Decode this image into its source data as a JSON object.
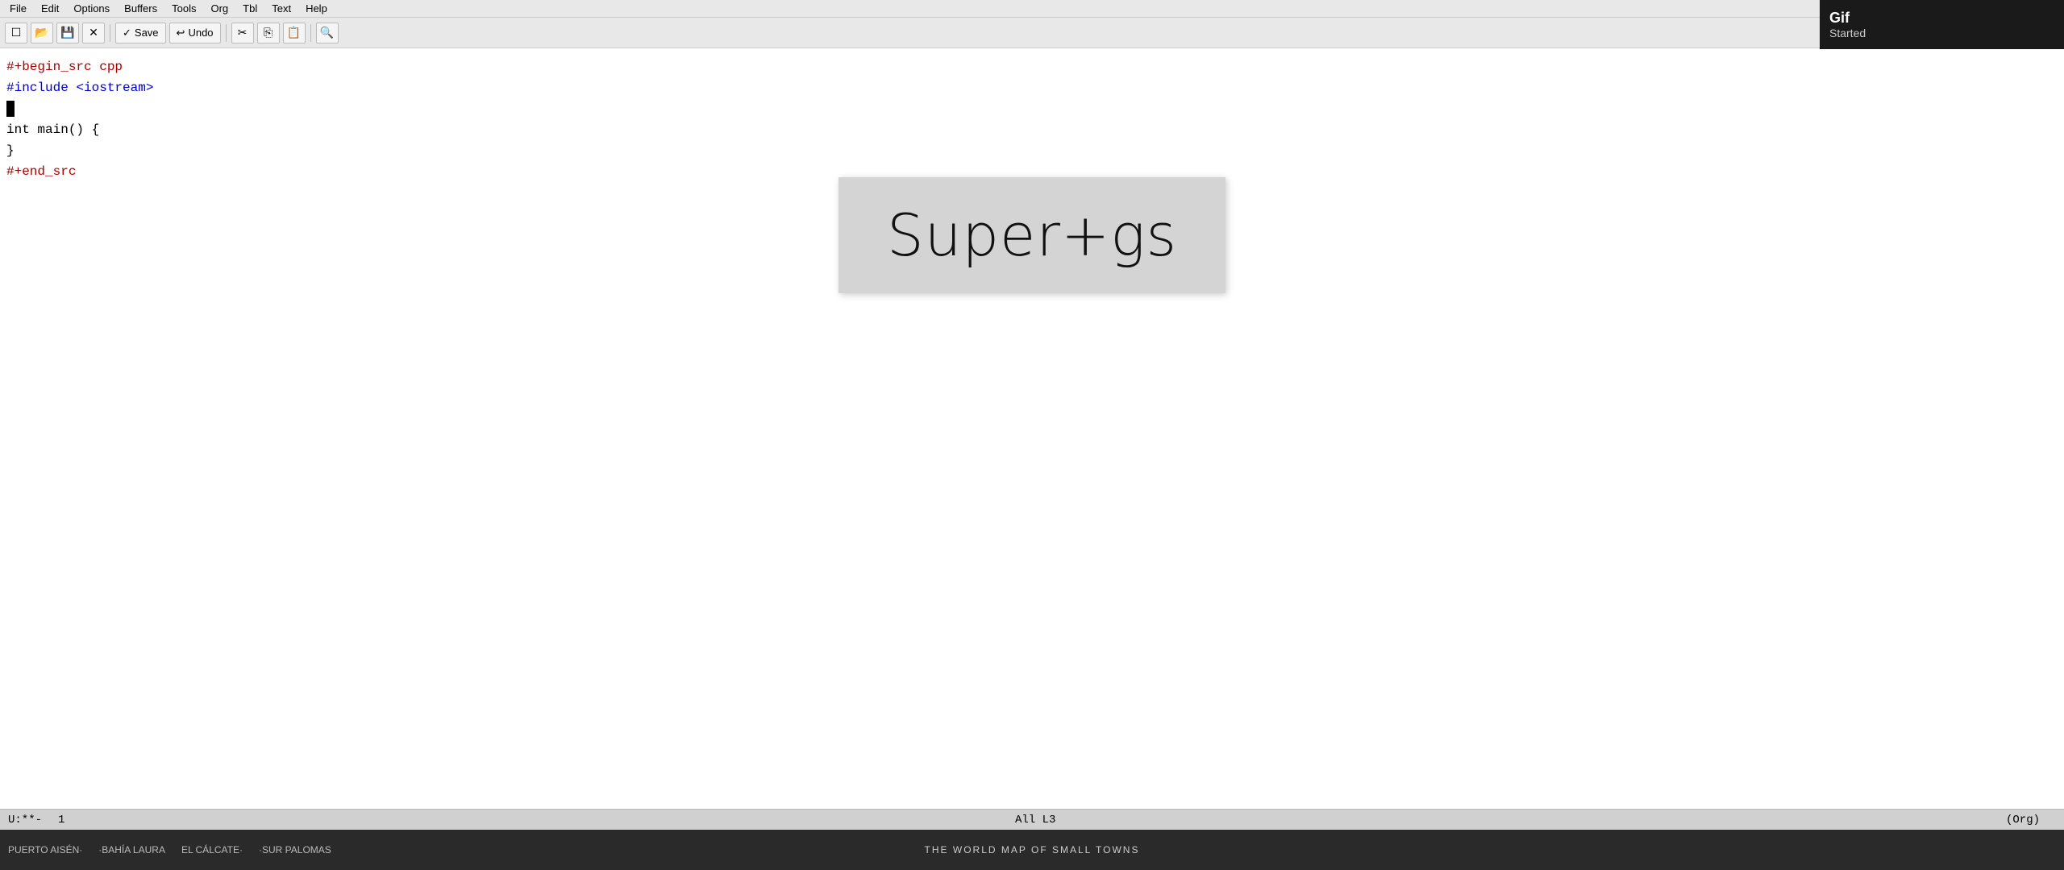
{
  "menubar": {
    "items": [
      "File",
      "Edit",
      "Options",
      "Buffers",
      "Tools",
      "Org",
      "Tbl",
      "Text",
      "Help"
    ]
  },
  "toolbar": {
    "buttons": [
      {
        "name": "new-file-btn",
        "icon": "📄"
      },
      {
        "name": "open-file-btn",
        "icon": "📂"
      },
      {
        "name": "save-file-btn-icon",
        "icon": "💾"
      },
      {
        "name": "close-btn",
        "icon": "✕"
      }
    ],
    "save_label": "Save",
    "undo_label": "Undo",
    "search_icon": "🔍"
  },
  "editor": {
    "lines": [
      {
        "id": 1,
        "text": "#",
        "rest": "+begin_src cpp",
        "color": "red"
      },
      {
        "id": 2,
        "text": "#include <iostream>",
        "color": "blue"
      },
      {
        "id": 3,
        "text": "",
        "cursor": true
      },
      {
        "id": 4,
        "text": "int main() {",
        "color": "black"
      },
      {
        "id": 5,
        "text": "}",
        "color": "black"
      },
      {
        "id": 6,
        "text": "#",
        "rest": "+end_src",
        "color": "red"
      }
    ]
  },
  "key_overlay": {
    "text": "Super+gs"
  },
  "statusbar": {
    "mode": "U:**-",
    "line": "1",
    "position": "All L3",
    "major_mode": "(Org)"
  },
  "taskbar": {
    "items": [
      {
        "label": "PUERTO AISÉN·",
        "value": ""
      },
      {
        "label": "·BAHÍA LAURA",
        "value": ""
      },
      {
        "label": "EL CÁLCATE·",
        "value": ""
      },
      {
        "label": "·SUR PALOMAS",
        "value": ""
      },
      {
        "label": "THE WORLD MAP OF SMALL TOWNS",
        "value": ""
      }
    ]
  },
  "gif_started": {
    "title": "Gif",
    "subtitle": "Started"
  }
}
